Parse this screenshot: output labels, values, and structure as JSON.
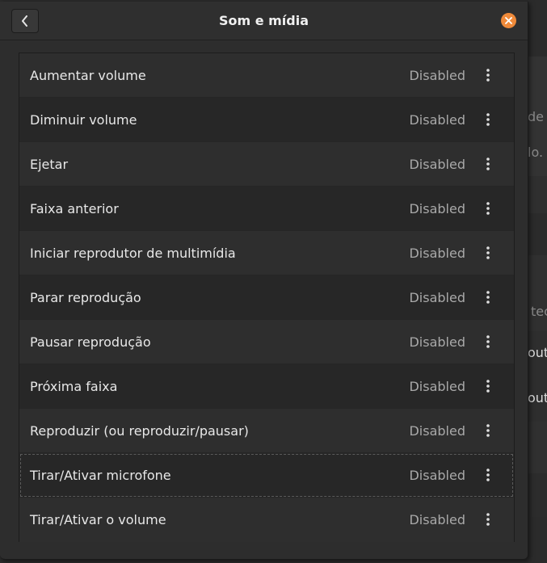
{
  "dialog": {
    "title": "Som e mídia",
    "back_icon": "chevron-left-icon",
    "close_icon": "close-icon",
    "accent_color": "#ef8a3a"
  },
  "shortcuts": [
    {
      "label": "Aumentar volume",
      "status": "Disabled"
    },
    {
      "label": "Diminuir volume",
      "status": "Disabled"
    },
    {
      "label": "Ejetar",
      "status": "Disabled"
    },
    {
      "label": "Faixa anterior",
      "status": "Disabled"
    },
    {
      "label": "Iniciar reprodutor de multimídia",
      "status": "Disabled"
    },
    {
      "label": "Parar reprodução",
      "status": "Disabled"
    },
    {
      "label": "Pausar reprodução",
      "status": "Disabled"
    },
    {
      "label": "Próxima faixa",
      "status": "Disabled"
    },
    {
      "label": "Reproduzir (ou reproduzir/pausar)",
      "status": "Disabled"
    },
    {
      "label": "Tirar/Ativar microfone",
      "status": "Disabled"
    },
    {
      "label": "Tirar/Ativar o volume",
      "status": "Disabled"
    }
  ],
  "background": {
    "fragments": [
      "de t",
      "lo.",
      "tec",
      "out",
      "out"
    ]
  }
}
